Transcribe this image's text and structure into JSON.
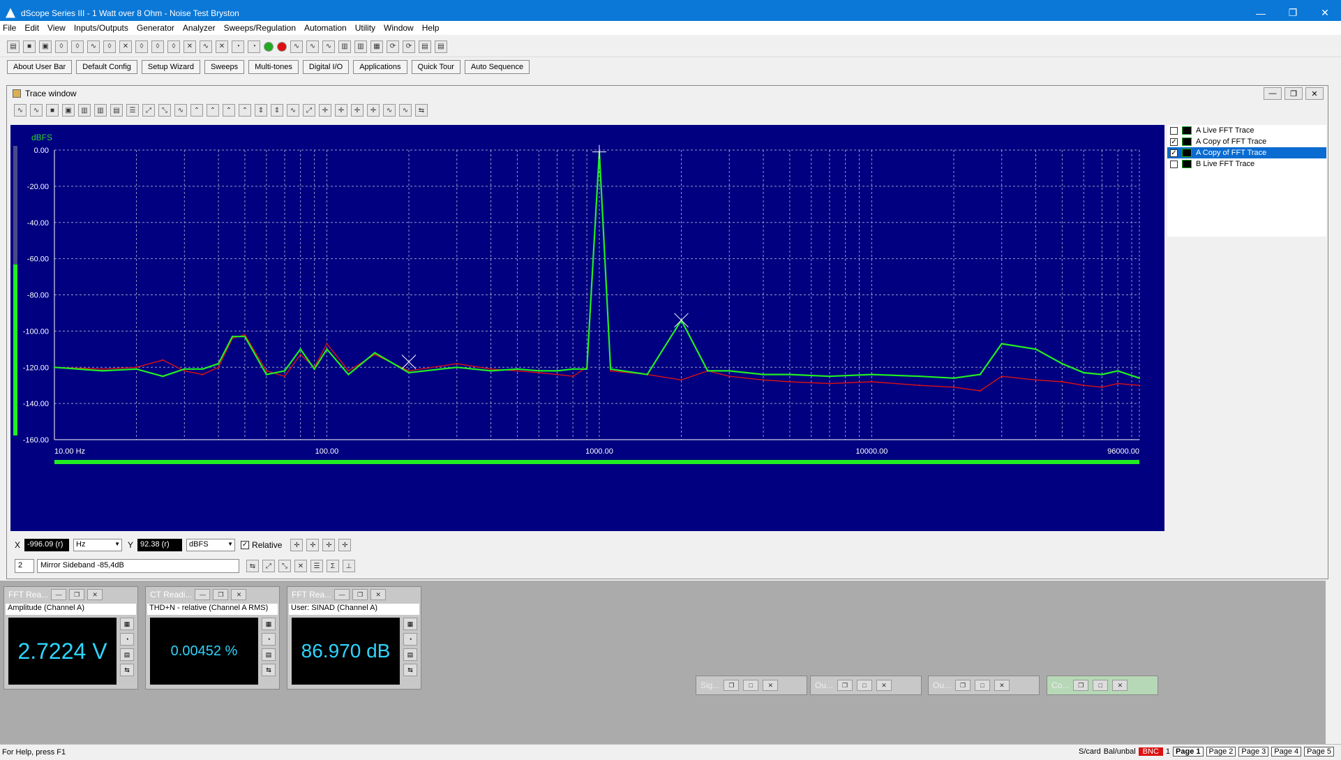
{
  "window": {
    "title": "dScope Series III - 1 Watt over 8 Ohm - Noise Test Bryston"
  },
  "menu": [
    "File",
    "Edit",
    "View",
    "Inputs/Outputs",
    "Generator",
    "Analyzer",
    "Sweeps/Regulation",
    "Automation",
    "Utility",
    "Window",
    "Help"
  ],
  "userbar": [
    "About User Bar",
    "Default Config",
    "Setup Wizard",
    "Sweeps",
    "Multi-tones",
    "Digital I/O",
    "Applications",
    "Quick Tour",
    "Auto Sequence"
  ],
  "trace_window": {
    "title": "Trace window",
    "legend": [
      {
        "label": "A  Live FFT Trace",
        "checked": false,
        "selected": false
      },
      {
        "label": "A  Copy of FFT Trace",
        "checked": true,
        "selected": false
      },
      {
        "label": "A  Copy of FFT Trace",
        "checked": true,
        "selected": true
      },
      {
        "label": "B  Live FFT Trace",
        "checked": false,
        "selected": false
      }
    ],
    "cursor": {
      "x_label": "X",
      "x_value": "-996.09 (r)",
      "x_unit": "Hz",
      "y_label": "Y",
      "y_value": "92.38 (r)",
      "y_unit": "dBFS",
      "relative_label": "Relative",
      "relative_checked": true
    },
    "annotation": {
      "number": "2",
      "text": "Mirror Sideband -85,4dB"
    }
  },
  "chart_data": {
    "type": "line",
    "ylabel": "dBFS",
    "xscale": "log",
    "xlim": [
      10,
      96000
    ],
    "ylim": [
      -160,
      0
    ],
    "y_ticks": [
      "0.00",
      "-20.00",
      "-40.00",
      "-60.00",
      "-80.00",
      "-100.00",
      "-120.00",
      "-140.00",
      "-160.00"
    ],
    "y_tick_values": [
      0,
      -20,
      -40,
      -60,
      -80,
      -100,
      -120,
      -140,
      -160
    ],
    "x_tick_labels": [
      "10.00 Hz",
      "100.00",
      "1000.00",
      "10000.00",
      "96000.00"
    ],
    "x_tick_values": [
      10,
      100,
      1000,
      10000,
      96000
    ],
    "grid": true,
    "background": "#000080",
    "series": [
      {
        "color": "#dd1111",
        "x": [
          10,
          15,
          20,
          25,
          30,
          35,
          40,
          45,
          50,
          60,
          70,
          80,
          90,
          100,
          120,
          150,
          200,
          300,
          400,
          500,
          600,
          700,
          800,
          900,
          1000,
          1100,
          1500,
          2000,
          2500,
          3000,
          4000,
          5000,
          7000,
          10000,
          15000,
          20000,
          25000,
          30000,
          40000,
          50000,
          60000,
          70000,
          80000,
          96000
        ],
        "y": [
          -120,
          -121,
          -120,
          -116,
          -122,
          -124,
          -120,
          -104,
          -102,
          -122,
          -125,
          -113,
          -120,
          -107,
          -122,
          -113,
          -122,
          -118,
          -121,
          -122,
          -123,
          -124,
          -125,
          -120,
          -1,
          -122,
          -124,
          -127,
          -122,
          -125,
          -127,
          -128,
          -129,
          -128,
          -130,
          -131,
          -133,
          -125,
          -127,
          -128,
          -130,
          -131,
          -129,
          -130
        ]
      },
      {
        "color": "#22ee22",
        "x": [
          10,
          15,
          20,
          25,
          30,
          35,
          40,
          45,
          50,
          60,
          70,
          80,
          90,
          100,
          120,
          150,
          200,
          300,
          400,
          500,
          600,
          700,
          800,
          900,
          1000,
          1100,
          1500,
          2000,
          2500,
          3000,
          4000,
          5000,
          7000,
          10000,
          15000,
          20000,
          25000,
          30000,
          40000,
          50000,
          60000,
          70000,
          80000,
          96000
        ],
        "y": [
          -120,
          -122,
          -121,
          -125,
          -121,
          -121,
          -118,
          -103,
          -103,
          -124,
          -122,
          -110,
          -121,
          -110,
          -124,
          -112,
          -123,
          -120,
          -122,
          -121,
          -122,
          -122,
          -121,
          -121,
          -1,
          -121,
          -124,
          -94,
          -122,
          -122,
          -124,
          -124,
          -125,
          -124,
          -125,
          -126,
          -124,
          -107,
          -110,
          -118,
          -123,
          -124,
          -122,
          -126
        ]
      }
    ],
    "annotations": [
      {
        "x": 1000,
        "y": -1,
        "marker": "+"
      },
      {
        "x": 2000,
        "y": -94,
        "marker": "x"
      },
      {
        "x": 200,
        "y": -117,
        "marker": "x"
      }
    ]
  },
  "readings": [
    {
      "title": "FFT Rea...",
      "label": "Amplitude (Channel A)",
      "value": "2.7224 V"
    },
    {
      "title": "CT Readi...",
      "label": "THD+N - relative (Channel A RMS)",
      "value": "0.00452 %"
    },
    {
      "title": "FFT Rea...",
      "label": "User: SINAD (Channel A)",
      "value": "86.970 dB"
    }
  ],
  "minimized": [
    "Sig...",
    "Ou...",
    "Ou...",
    "Co..."
  ],
  "status": {
    "help": "For Help, press F1",
    "items": [
      "S/card",
      "Bal/unbal",
      "BNC",
      "1"
    ],
    "pages": [
      "Page 1",
      "Page 2",
      "Page 3",
      "Page 4",
      "Page 5"
    ]
  }
}
